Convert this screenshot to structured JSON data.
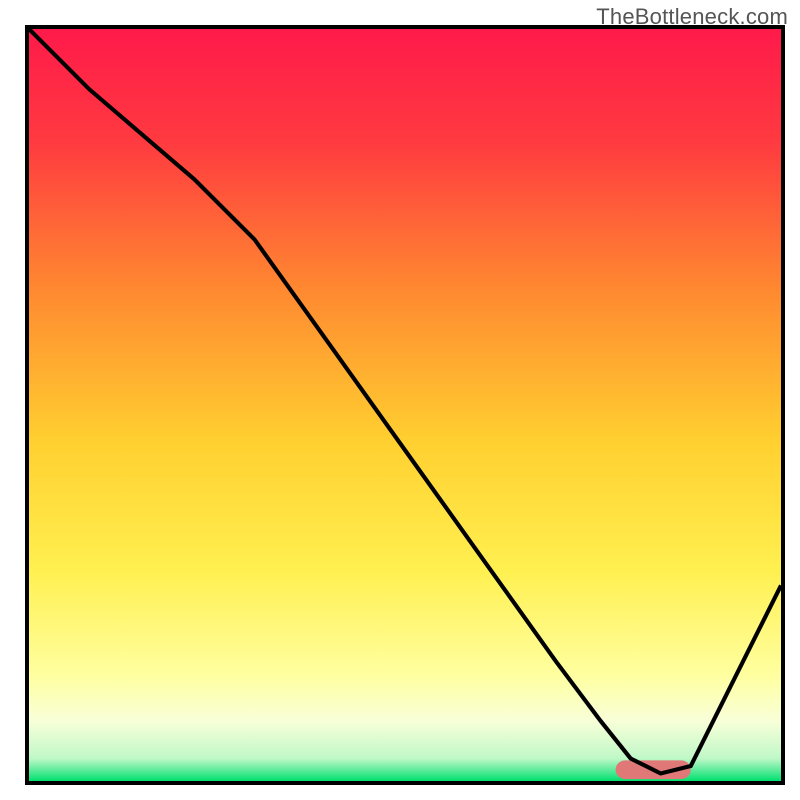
{
  "watermark": "TheBottleneck.com",
  "chart_data": {
    "type": "line",
    "title": "",
    "xlabel": "",
    "ylabel": "",
    "xlim": [
      0,
      100
    ],
    "ylim": [
      0,
      100
    ],
    "background_gradient": {
      "stops": [
        {
          "pos": 0.0,
          "color": "#ff1a4a"
        },
        {
          "pos": 0.15,
          "color": "#ff3a40"
        },
        {
          "pos": 0.35,
          "color": "#ff8a30"
        },
        {
          "pos": 0.55,
          "color": "#ffd030"
        },
        {
          "pos": 0.72,
          "color": "#fff050"
        },
        {
          "pos": 0.86,
          "color": "#ffffa0"
        },
        {
          "pos": 0.92,
          "color": "#f8ffd8"
        },
        {
          "pos": 0.97,
          "color": "#c0f8c8"
        },
        {
          "pos": 1.0,
          "color": "#00e070"
        }
      ]
    },
    "series": [
      {
        "name": "bottleneck-curve",
        "color": "#000000",
        "x": [
          0,
          8,
          22,
          30,
          40,
          50,
          60,
          70,
          76,
          80,
          84,
          88,
          92,
          100
        ],
        "y": [
          100,
          92,
          80,
          72,
          58,
          44,
          30,
          16,
          8,
          3,
          1,
          2,
          10,
          26
        ]
      }
    ],
    "marker": {
      "name": "optimal-range",
      "color": "#e07878",
      "x_start": 78,
      "x_end": 88,
      "y": 1.5,
      "height": 2.5,
      "radius": 1.3
    }
  }
}
